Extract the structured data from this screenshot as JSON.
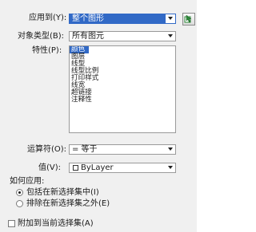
{
  "apply_to": {
    "label": "应用到(Y):",
    "value": "整个图形"
  },
  "object_type": {
    "label": "对象类型(B):",
    "value": "所有图元"
  },
  "properties": {
    "label": "特性(P):",
    "items": [
      "颜色",
      "图层",
      "线型",
      "线型比例",
      "打印样式",
      "线宽",
      "超链接",
      "注释性"
    ],
    "selected_index": 0
  },
  "operator": {
    "label": "运算符(O):",
    "value": "= 等于"
  },
  "value_field": {
    "label": "值(V):",
    "value": "ByLayer",
    "swatch_color": "#ffffff"
  },
  "how_to_apply": {
    "label": "如何应用:",
    "options": [
      {
        "label": "包括在新选择集中(I)",
        "selected": true
      },
      {
        "label": "排除在新选择集之外(E)",
        "selected": false
      }
    ]
  },
  "append": {
    "label": "附加到当前选择集(A)",
    "checked": false
  },
  "colors": {
    "highlight": "#3169c6",
    "dialog_bg": "#f0f0f0"
  },
  "icons": {
    "select_objects_button": "select-objects-icon"
  }
}
